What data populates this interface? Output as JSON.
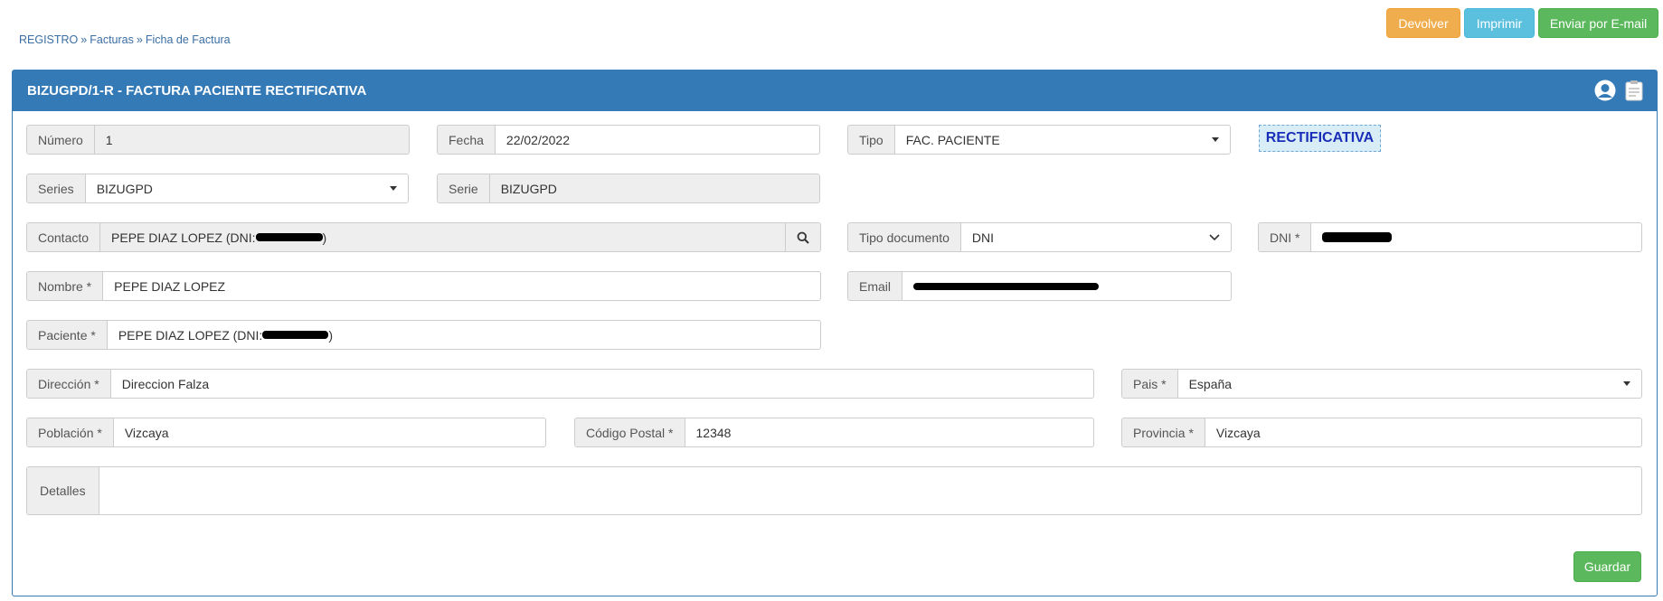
{
  "breadcrumb": [
    "REGISTRO",
    "Facturas",
    "Ficha de Factura"
  ],
  "breadcrumb_sep": "»",
  "toolbar": {
    "devolver": "Devolver",
    "imprimir": "Imprimir",
    "email": "Enviar por E-mail"
  },
  "panel": {
    "title": "BIZUGPD/1-R - FACTURA PACIENTE RECTIFICATIVA",
    "icons": [
      "user-icon",
      "clipboard-icon"
    ]
  },
  "fields": {
    "numero": {
      "label": "Número",
      "value": "1"
    },
    "fecha": {
      "label": "Fecha",
      "value": "22/02/2022"
    },
    "tipo": {
      "label": "Tipo",
      "value": "FAC. PACIENTE"
    },
    "series": {
      "label": "Series",
      "value": "BIZUGPD"
    },
    "serie": {
      "label": "Serie",
      "value": "BIZUGPD"
    },
    "contacto": {
      "label": "Contacto",
      "value": "PEPE DIAZ LOPEZ (DNI: ",
      "suffix": ")"
    },
    "tipo_documento": {
      "label": "Tipo documento",
      "value": "DNI"
    },
    "dni": {
      "label": "DNI *",
      "value": ""
    },
    "nombre": {
      "label": "Nombre *",
      "value": "PEPE DIAZ LOPEZ"
    },
    "email": {
      "label": "Email",
      "value": ""
    },
    "paciente": {
      "label": "Paciente *",
      "value": "PEPE DIAZ LOPEZ (DNI: ",
      "suffix": ")"
    },
    "direccion": {
      "label": "Dirección *",
      "value": "Direccion Falza"
    },
    "pais": {
      "label": "Pais *",
      "value": "España"
    },
    "poblacion": {
      "label": "Población *",
      "value": "Vizcaya"
    },
    "codigo_postal": {
      "label": "Código Postal *",
      "value": "12348"
    },
    "provincia": {
      "label": "Provincia *",
      "value": "Vizcaya"
    },
    "detalles": {
      "label": "Detalles",
      "value": ""
    }
  },
  "status_badge": "RECTIFICATIVA",
  "save_label": "Guardar",
  "colors": {
    "primary": "#337ab7",
    "warning": "#f0ad4e",
    "info": "#5bc0de",
    "success": "#5cb85c",
    "badge_text": "#1a2fb8"
  }
}
